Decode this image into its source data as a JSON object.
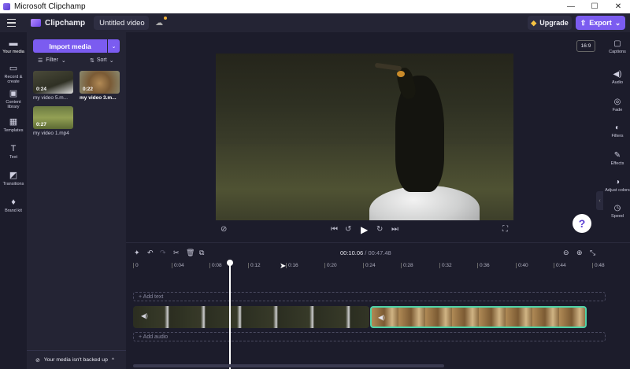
{
  "window": {
    "title": "Microsoft Clipchamp",
    "min": "—",
    "max": "☐",
    "close": "✕"
  },
  "header": {
    "brand": "Clipchamp",
    "project_name": "Untitled video",
    "upgrade_label": "Upgrade",
    "export_label": "Export",
    "export_caret": "⌄"
  },
  "nav": [
    {
      "icon": "folder",
      "glyph": "▬",
      "label": "Your media",
      "active": true
    },
    {
      "icon": "camera",
      "glyph": "▭",
      "label": "Record & create"
    },
    {
      "icon": "library",
      "glyph": "▣",
      "label": "Content library"
    },
    {
      "icon": "templates",
      "glyph": "▦",
      "label": "Templates"
    },
    {
      "icon": "text",
      "glyph": "T",
      "label": "Text"
    },
    {
      "icon": "transitions",
      "glyph": "◩",
      "label": "Transitions"
    },
    {
      "icon": "brand-kit",
      "glyph": "♦",
      "label": "Brand kit"
    }
  ],
  "media": {
    "import_label": "Import media",
    "import_caret": "⌄",
    "filter_label": "Filter",
    "filter_caret": "⌄",
    "sort_label": "Sort",
    "sort_caret": "⌄",
    "items": [
      {
        "name": "my video 5.m...",
        "duration": "0:24"
      },
      {
        "name": "my video 3.m...",
        "duration": "0:22"
      },
      {
        "name": "my video 1.mp4",
        "duration": "0:27"
      }
    ],
    "backup_text": "Your media isn't backed up",
    "backup_caret": "^"
  },
  "preview": {
    "aspect_ratio": "16:9",
    "help": "?"
  },
  "right_panel": [
    {
      "icon": "captions",
      "glyph": "▢",
      "label": "Captions"
    },
    {
      "icon": "audio",
      "glyph": "◀)",
      "label": "Audio"
    },
    {
      "icon": "fade",
      "glyph": "◎",
      "label": "Fade"
    },
    {
      "icon": "filters",
      "glyph": "◐",
      "label": "Filters"
    },
    {
      "icon": "effects",
      "glyph": "✎",
      "label": "Effects"
    },
    {
      "icon": "adjust-colors",
      "glyph": "◑",
      "label": "Adjust colors"
    },
    {
      "icon": "speed",
      "glyph": "◷",
      "label": "Speed"
    }
  ],
  "timeline": {
    "current_time": "00:10.06",
    "separator": " / ",
    "total_time": "00:47.48",
    "ticks": [
      "0",
      "0:04",
      "0:08",
      "0:12",
      "0:16",
      "0:20",
      "0:24",
      "0:28",
      "0:32",
      "0:36",
      "0:40",
      "0:44",
      "0:48"
    ],
    "add_text_label": "+ Add text",
    "add_audio_label": "+ Add audio"
  }
}
